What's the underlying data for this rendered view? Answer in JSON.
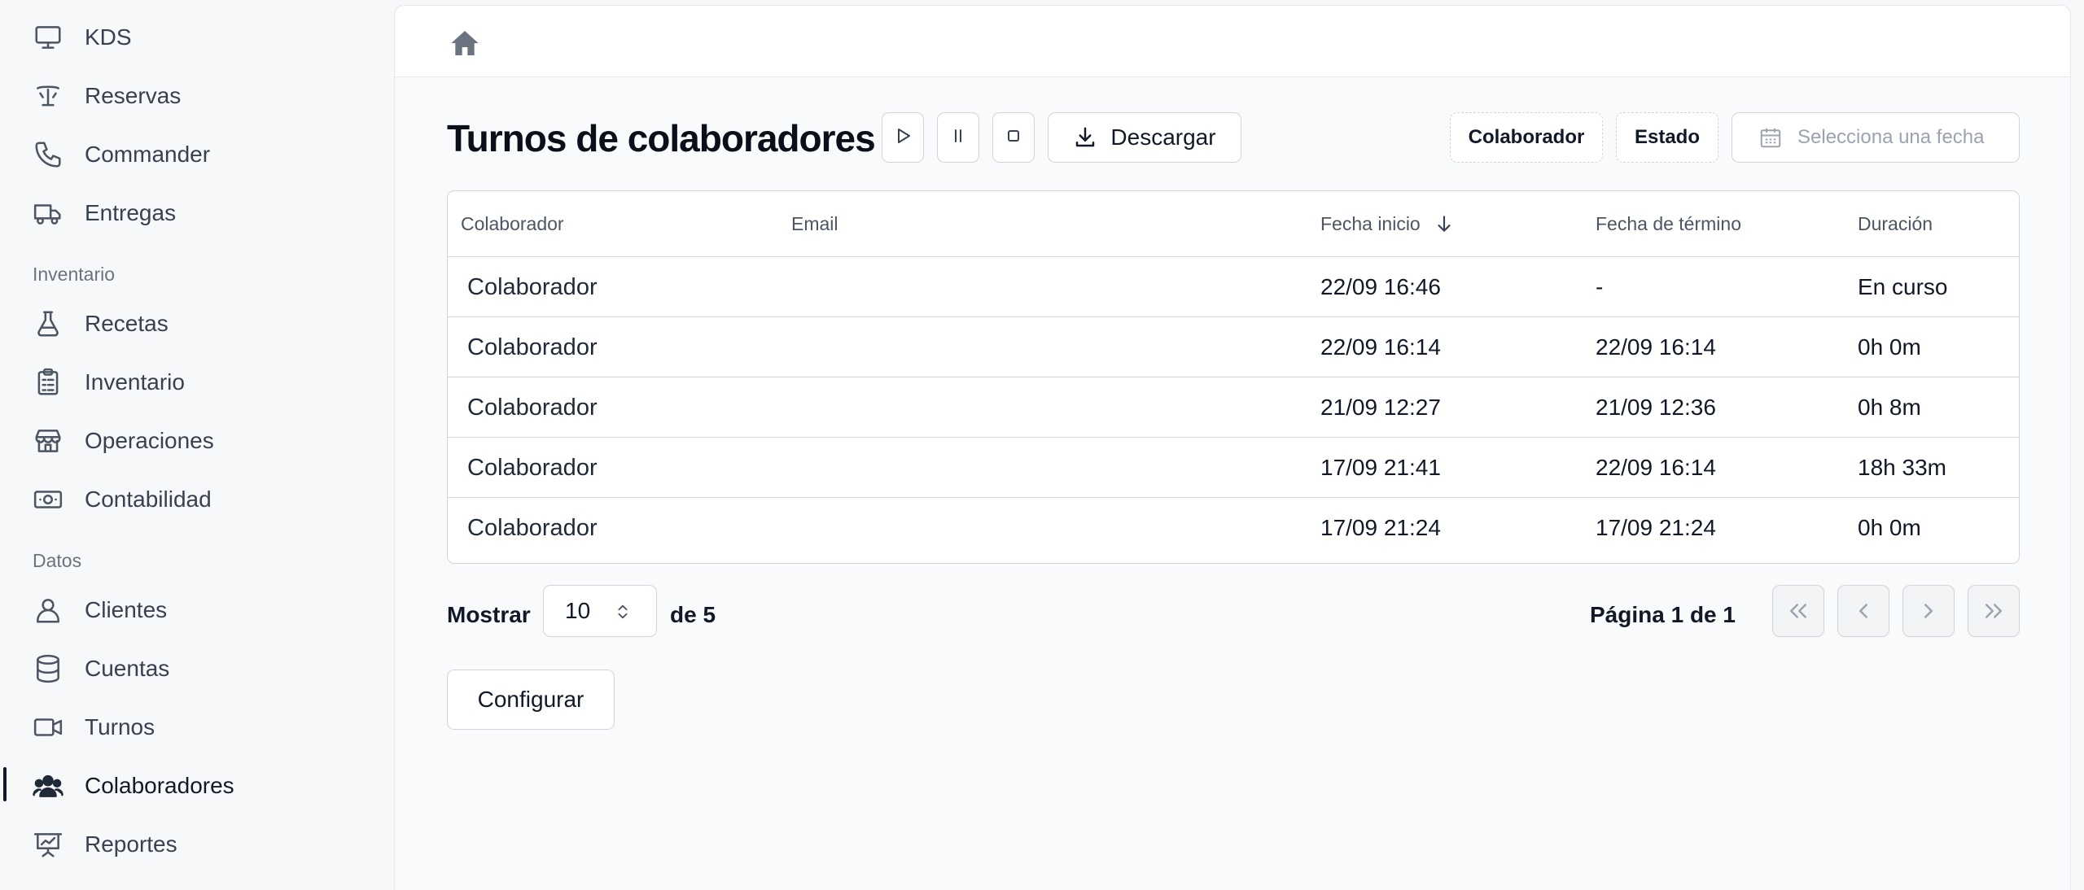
{
  "sidebar": {
    "items_top": [
      {
        "label": "KDS",
        "icon": "monitor-icon"
      },
      {
        "label": "Reservas",
        "icon": "table-icon"
      },
      {
        "label": "Commander",
        "icon": "phone-icon"
      },
      {
        "label": "Entregas",
        "icon": "truck-icon"
      }
    ],
    "section_inventory": "Inventario",
    "items_inventory": [
      {
        "label": "Recetas",
        "icon": "flask-icon"
      },
      {
        "label": "Inventario",
        "icon": "clipboard-icon"
      },
      {
        "label": "Operaciones",
        "icon": "store-icon"
      },
      {
        "label": "Contabilidad",
        "icon": "banknote-icon"
      }
    ],
    "section_data": "Datos",
    "items_data": [
      {
        "label": "Clientes",
        "icon": "user-icon"
      },
      {
        "label": "Cuentas",
        "icon": "database-icon"
      },
      {
        "label": "Turnos",
        "icon": "video-icon"
      },
      {
        "label": "Colaboradores",
        "icon": "users-icon",
        "active": true
      },
      {
        "label": "Reportes",
        "icon": "presentation-chart-icon"
      }
    ]
  },
  "header": {
    "title": "Turnos de colaboradores",
    "download_label": "Descargar",
    "filter_collaborator": "Colaborador",
    "filter_status": "Estado",
    "date_placeholder": "Selecciona una fecha"
  },
  "table": {
    "columns": {
      "collaborator": "Colaborador",
      "email": "Email",
      "start": "Fecha inicio",
      "end": "Fecha de término",
      "duration": "Duración"
    },
    "rows": [
      {
        "collaborator": "Colaborador",
        "email": "",
        "start": "22/09 16:46",
        "end": "-",
        "duration": "En curso"
      },
      {
        "collaborator": "Colaborador",
        "email": "",
        "start": "22/09 16:14",
        "end": "22/09 16:14",
        "duration": "0h 0m"
      },
      {
        "collaborator": "Colaborador",
        "email": "",
        "start": "21/09 12:27",
        "end": "21/09 12:36",
        "duration": "0h 8m"
      },
      {
        "collaborator": "Colaborador",
        "email": "",
        "start": "17/09 21:41",
        "end": "22/09 16:14",
        "duration": "18h 33m"
      },
      {
        "collaborator": "Colaborador",
        "email": "",
        "start": "17/09 21:24",
        "end": "17/09 21:24",
        "duration": "0h 0m"
      }
    ]
  },
  "pagination": {
    "show_label": "Mostrar",
    "page_size": "10",
    "of_label": "de 5",
    "page_info": "Página 1 de 1"
  },
  "config_label": "Configurar"
}
